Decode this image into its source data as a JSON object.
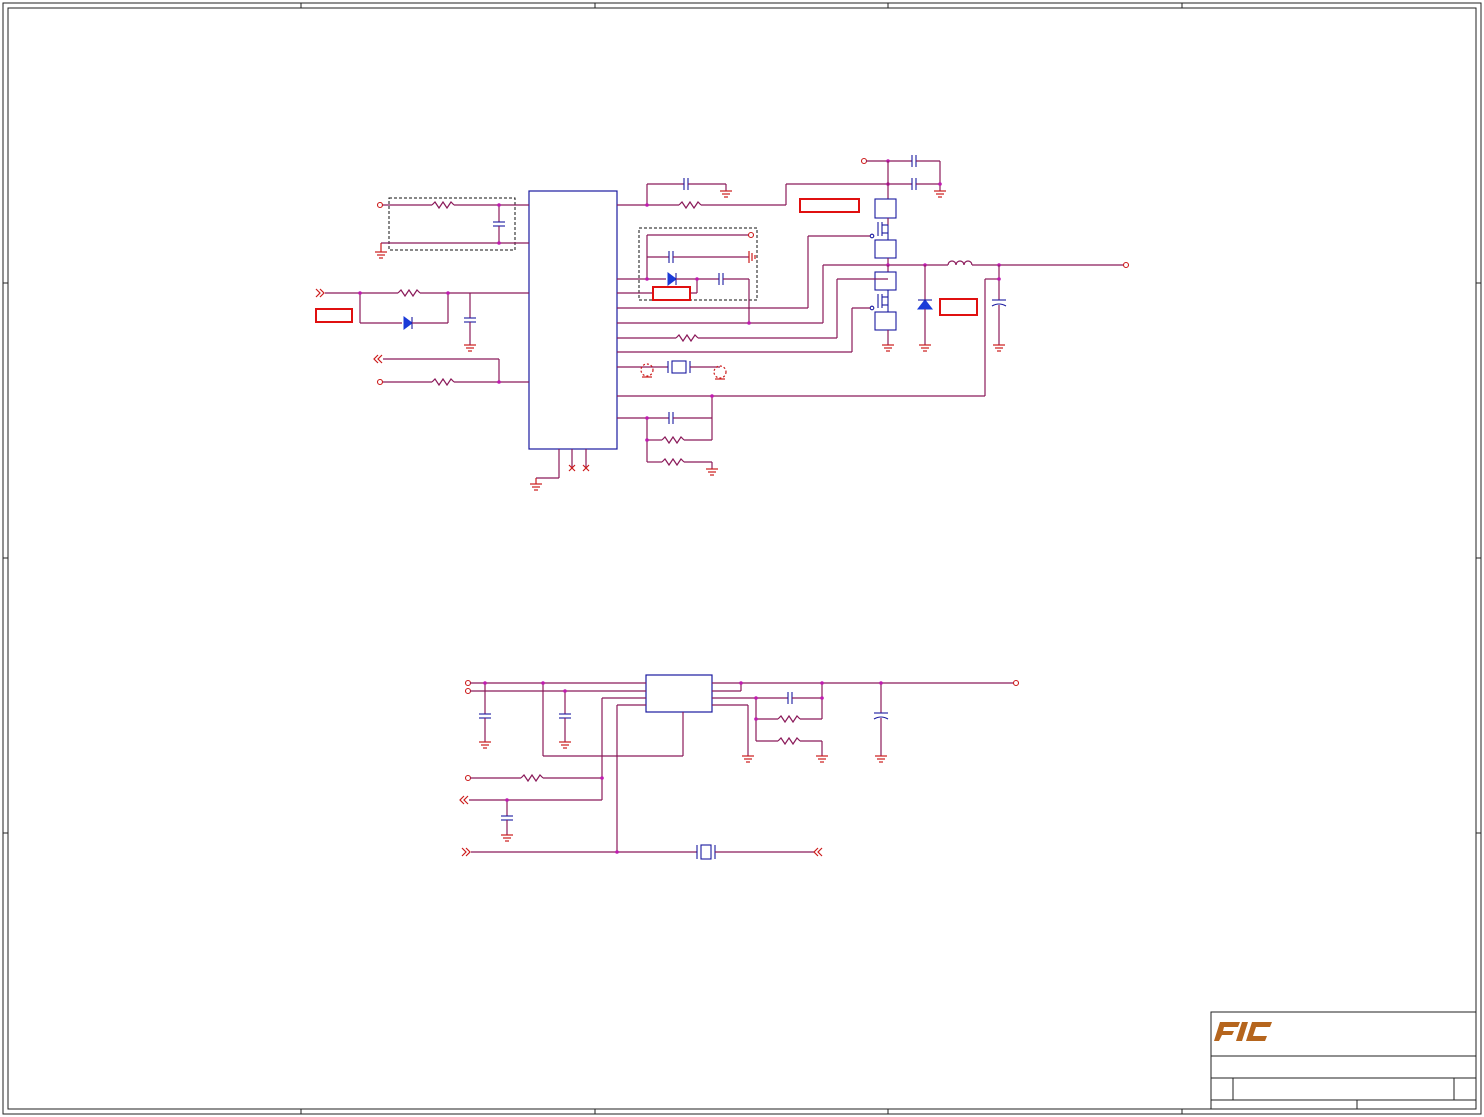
{
  "colors": {
    "wire": "#8b1a5a",
    "pin": "#cc1b1b",
    "part": "#1a1aa0",
    "junction": "#c01ab0",
    "highlight": "#e01010",
    "logo": "#b5651d"
  },
  "title_block": {
    "logo_icon": "company-logo-icon"
  }
}
